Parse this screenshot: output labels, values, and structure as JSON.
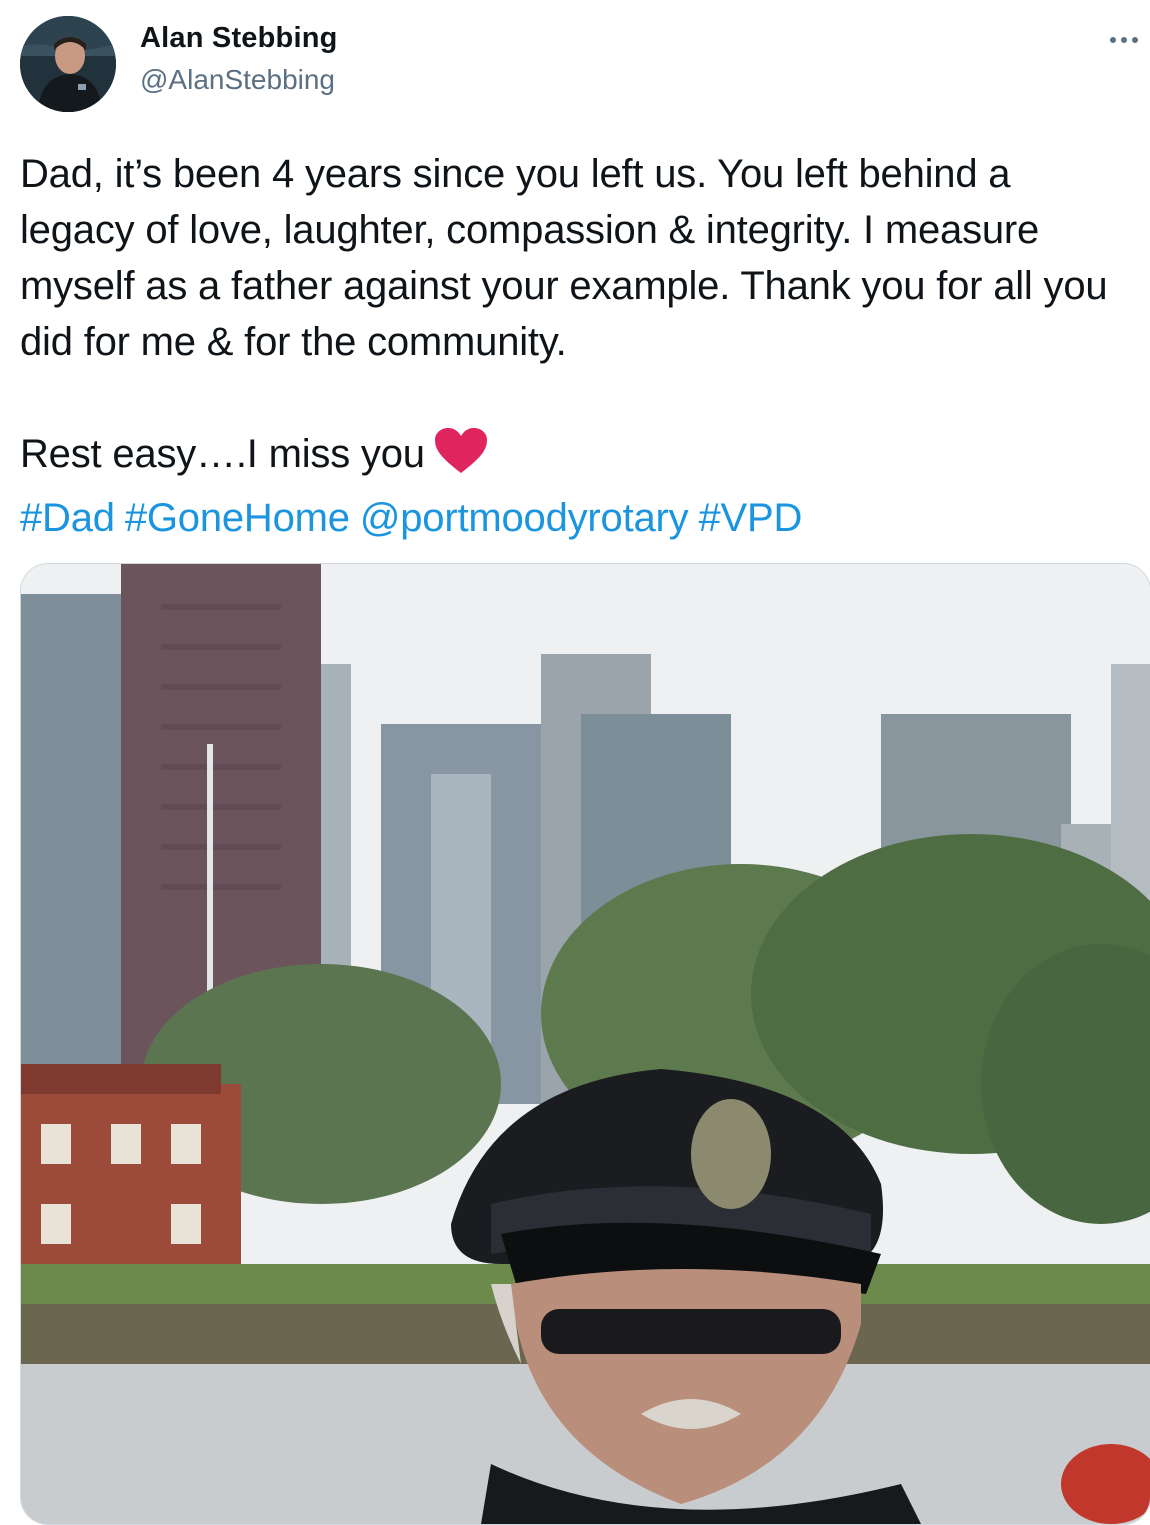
{
  "author": {
    "display_name": "Alan Stebbing",
    "handle": "@AlanStebbing"
  },
  "more_icon": "more-horizontal-icon",
  "tweet": {
    "paragraph_1": "Dad, it’s been 4 years since you left us. You left behind a legacy of love, laughter, compassion & integrity. I measure myself as a father against your example. Thank you for all you did for me & for the community.",
    "line_2": "Rest easy….I miss you",
    "emoji": "red-heart-icon",
    "tags": [
      "#Dad",
      "#GoneHome",
      "@portmoodyrotary",
      "#VPD"
    ]
  },
  "colors": {
    "link": "#1b95e0",
    "secondary_text": "#5b7083",
    "heart": "#e0245e"
  }
}
